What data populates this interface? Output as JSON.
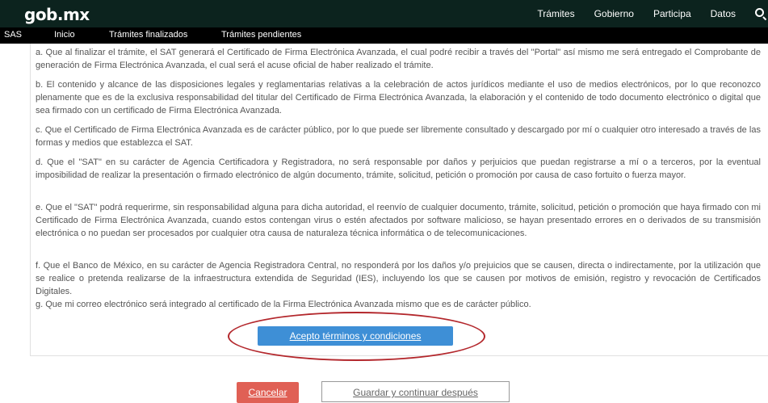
{
  "header": {
    "logo": "gob.mx",
    "nav": [
      "Trámites",
      "Gobierno",
      "Participa",
      "Datos"
    ],
    "search_icon": "search-icon"
  },
  "subnav": {
    "brand": "SAS",
    "items": [
      "Inicio",
      "Trámites finalizados",
      "Trámites pendientes"
    ]
  },
  "terms": [
    "a. Que al finalizar el trámite, el SAT generará el Certificado de Firma Electrónica Avanzada, el cual podré recibir a través del \"Portal\" así mismo me será entregado el Comprobante de generación de Firma Electrónica Avanzada, el cual será el acuse oficial de haber realizado el trámite.",
    "b. El contenido y alcance de las disposiciones legales y reglamentarias relativas a la celebración de actos jurídicos mediante el uso de medios electrónicos, por lo que reconozco plenamente que es de la exclusiva responsabilidad del titular del Certificado de Firma Electrónica Avanzada, la elaboración y el contenido de todo documento electrónico o digital que sea firmado con un certificado de Firma Electrónica Avanzada.",
    "c. Que el Certificado de Firma Electrónica Avanzada es de carácter público, por lo que puede ser libremente consultado y descargado por mí o cualquier otro interesado a través de las formas y medios que establezca el SAT.",
    "d. Que el \"SAT\" en su carácter de Agencia Certificadora y Registradora, no será responsable por daños y perjuicios que puedan registrarse a mí o a terceros, por la eventual imposibilidad de realizar la presentación o firmado electrónico de algún documento, trámite, solicitud, petición o promoción por causa de caso fortuito o fuerza mayor.",
    "e. Que el \"SAT\" podrá requerirme, sin responsabilidad alguna para dicha autoridad, el reenvío de cualquier documento, trámite, solicitud, petición o promoción que haya firmado con mi Certificado de Firma Electrónica Avanzada, cuando estos contengan virus o estén afectados por software malicioso, se hayan presentado errores en o derivados de su transmisión electrónica o no puedan ser procesados por cualquier otra causa de naturaleza técnica informática o de telecomunicaciones.",
    "f. Que el Banco de México, en su carácter de Agencia Registradora Central, no responderá por los daños y/o prejuicios que se causen, directa o indirectamente, por la utilización que se realice o pretenda realizarse de la infraestructura extendida de Seguridad (IES), incluyendo los que se causen por motivos de emisión, registro y revocación de Certificados Digitales.",
    "g. Que mi correo electrónico será integrado al certificado de la Firma Electrónica Avanzada mismo que es de carácter público."
  ],
  "actions": {
    "accept": "Acepto términos y condiciones",
    "cancel": "Cancelar",
    "save": "Guardar y continuar después"
  },
  "colors": {
    "header_bg": "#0c231e",
    "accept_bg": "#3e8fd6",
    "cancel_bg": "#e06055",
    "highlight": "#b3272c"
  }
}
